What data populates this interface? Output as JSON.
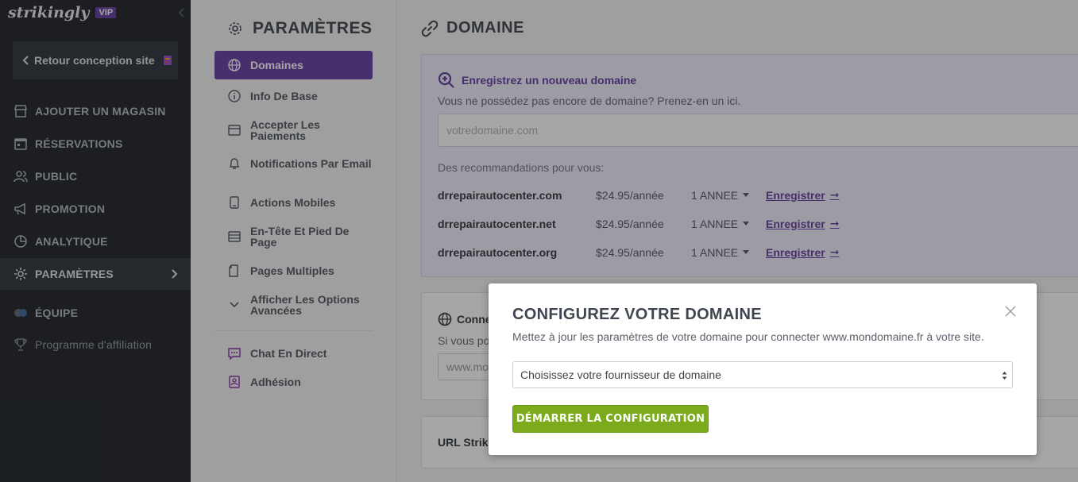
{
  "brand": {
    "logo": "strikingly",
    "badge": "VIP"
  },
  "sidebar": {
    "back_label": "Retour conception site",
    "items": [
      {
        "label": "AJOUTER UN MAGASIN",
        "icon": "store-icon"
      },
      {
        "label": "RÉSERVATIONS",
        "icon": "calendar-icon"
      },
      {
        "label": "PUBLIC",
        "icon": "users-icon"
      },
      {
        "label": "PROMOTION",
        "icon": "megaphone-icon"
      },
      {
        "label": "ANALYTIQUE",
        "icon": "pie-chart-icon"
      },
      {
        "label": "PARAMÈTRES",
        "icon": "gear-icon",
        "active": true
      },
      {
        "label": "ÉQUIPE",
        "icon": "team-icon"
      },
      {
        "label": "Programme d'affiliation",
        "icon": "trophy-icon"
      }
    ]
  },
  "settings": {
    "title": "PARAMÈTRES",
    "items": [
      {
        "label": "Domaines",
        "icon": "globe-icon",
        "active": true
      },
      {
        "label": "Info De Base",
        "icon": "info-icon"
      },
      {
        "label": "Accepter Les Paiements",
        "icon": "card-icon"
      },
      {
        "label": "Notifications Par Email",
        "icon": "bell-icon"
      },
      {
        "label": "Actions Mobiles",
        "icon": "mobile-icon"
      },
      {
        "label": "En-Tête Et Pied De Page",
        "icon": "layout-icon"
      },
      {
        "label": "Pages Multiples",
        "icon": "pages-icon"
      },
      {
        "label": "Afficher Les Options Avancées",
        "icon": "chevron-down-icon"
      },
      {
        "label": "Chat En Direct",
        "icon": "chat-icon"
      },
      {
        "label": "Adhésion",
        "icon": "member-icon"
      }
    ]
  },
  "main": {
    "title": "DOMAINE",
    "register": {
      "heading": "Enregistrez un nouveau domaine",
      "subtitle": "Vous ne possédez pas encore de domaine? Prenez-en un ici.",
      "input_placeholder": "votredomaine.com",
      "rec_label": "Des recommandations pour vous:",
      "rows": [
        {
          "name": "drrepairautocenter.com",
          "price": "$24.95/année",
          "term": "1 ANNEE",
          "link": "Enregistrer"
        },
        {
          "name": "drrepairautocenter.net",
          "price": "$24.95/année",
          "term": "1 ANNEE",
          "link": "Enregistrer"
        },
        {
          "name": "drrepairautocenter.org",
          "price": "$24.95/année",
          "term": "1 ANNEE",
          "link": "Enregistrer"
        }
      ]
    },
    "connect": {
      "heading": "Conne",
      "subtitle": "Si vous po",
      "input_value": "www.mo"
    },
    "url": {
      "heading": "URL Strik"
    }
  },
  "modal": {
    "title": "CONFIGUREZ VOTRE DOMAINE",
    "description": "Mettez à jour les paramètres de votre domaine pour connecter www.mondomaine.fr à votre site.",
    "select_value": "Choisissez votre fournisseur de domaine",
    "button": "DÉMARRER LA CONFIGURATION"
  },
  "colors": {
    "accent": "#6d49a8",
    "sidebar_bg": "#2b2f33",
    "cta": "#7bab1c"
  }
}
